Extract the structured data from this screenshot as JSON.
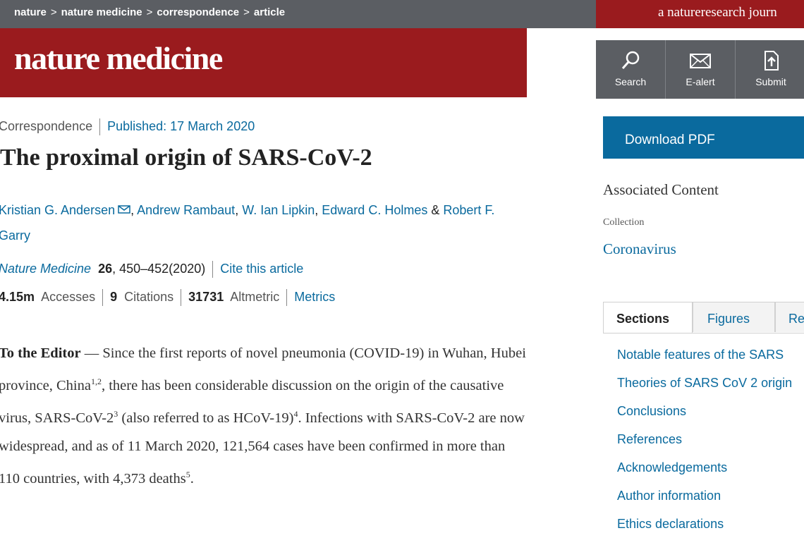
{
  "breadcrumb": [
    "nature",
    "nature medicine",
    "correspondence",
    "article"
  ],
  "journal_strip": "a natureresearch journ",
  "logo": "nature medicine",
  "tools": [
    {
      "label": "Search",
      "icon": "search-icon"
    },
    {
      "label": "E-alert",
      "icon": "envelope-icon"
    },
    {
      "label": "Submit",
      "icon": "upload-icon"
    }
  ],
  "download_pdf": "Download PDF",
  "associated": {
    "title": "Associated Content",
    "collection_label": "Collection",
    "collection_link": "Coronavirus"
  },
  "tabs": [
    "Sections",
    "Figures",
    "Ref"
  ],
  "sections": [
    "Notable features of the SARS",
    "Theories of SARS CoV 2 origin",
    "Conclusions",
    "References",
    "Acknowledgements",
    "Author information",
    "Ethics declarations"
  ],
  "article": {
    "type": "Correspondence",
    "published": "Published: 17 March 2020",
    "title": "The proximal origin of SARS-CoV-2",
    "authors": [
      "Kristian G. Andersen",
      "Andrew Rambaut",
      "W. Ian Lipkin",
      "Edward C. Holmes",
      "Robert F. Garry"
    ],
    "journal": "Nature Medicine",
    "volume": "26",
    "pages": ", 450–452(2020)",
    "cite": "Cite this article",
    "accesses_value": "4.15m",
    "accesses_label": "Accesses",
    "citations_value": "9",
    "citations_label": "Citations",
    "altmetric_value": "31731",
    "altmetric_label": "Altmetric",
    "metrics_link": "Metrics"
  },
  "body": {
    "lead": "To the Editor",
    "dash": " — ",
    "p1": "Since the first reports of novel pneumonia (COVID-19) in Wuhan, Hubei province, China",
    "sup1": "1,2",
    "p2": ", there has been considerable discussion on the origin of the causative virus, SARS-CoV-2",
    "sup2": "3",
    "p3": " (also referred to as HCoV-19)",
    "sup3": "4",
    "p4": ". Infections with SARS-CoV-2 are now widespread, and as of 11 March 2020, 121,564 cases have been confirmed in more than 110 countries, with 4,373 deaths",
    "sup4": "5",
    "p5": "."
  },
  "colors": {
    "brand_red": "#9a1b1e",
    "dark_gray": "#5b5e63",
    "link_blue": "#0a6a9e"
  }
}
